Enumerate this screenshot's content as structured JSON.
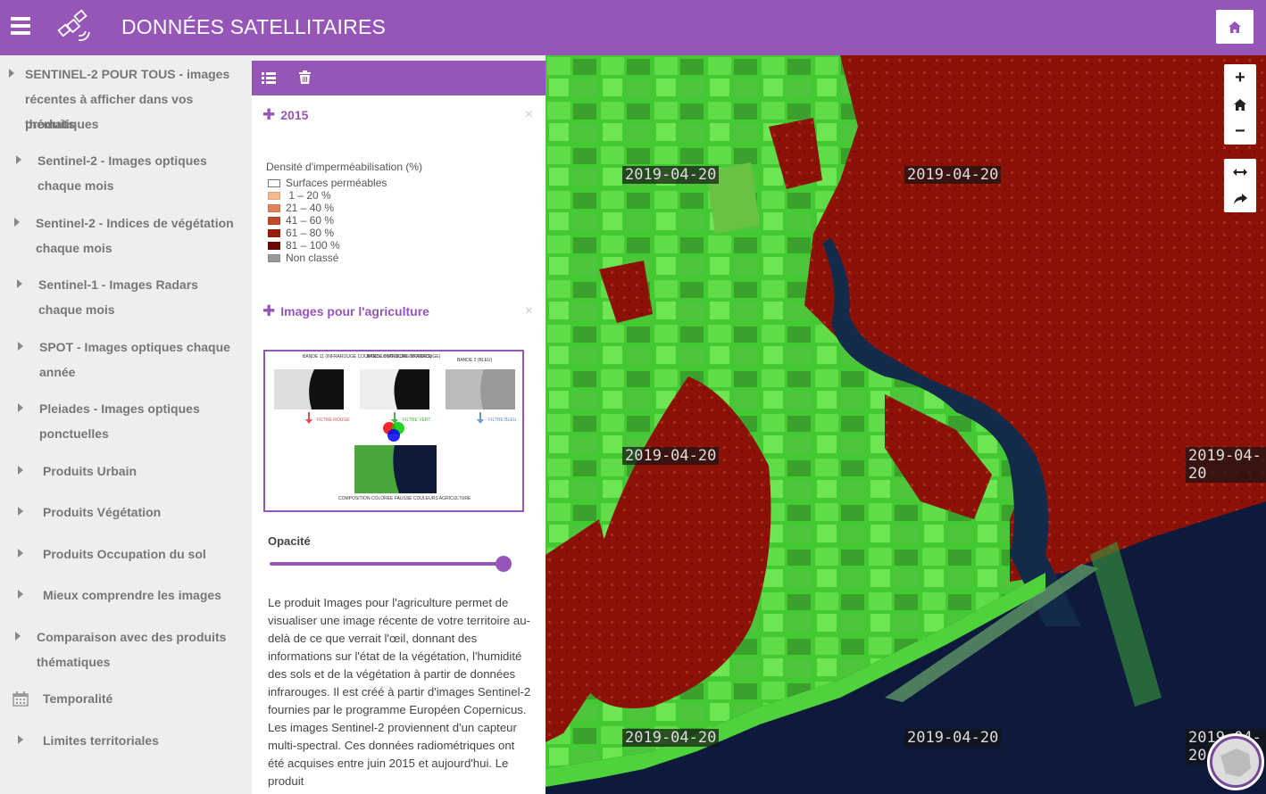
{
  "header": {
    "title": "DONNÉES SATELLITAIRES",
    "menu_icon": "hamburger-icon",
    "logo_icon": "satellite-icon",
    "home_icon": "home-icon"
  },
  "sidebar": {
    "items": [
      {
        "label_line1": "SENTINEL-2 POUR TOUS - images",
        "label_line2": "récentes à afficher dans vos produits",
        "label_line3": "thématiques"
      },
      {
        "label_line1": "Sentinel-2 - Images optiques",
        "label_line2": "chaque mois"
      },
      {
        "label_line1": "Sentinel-2 - Indices de végétation",
        "label_line2": "chaque mois"
      },
      {
        "label_line1": "Sentinel-1 - Images Radars",
        "label_line2": "chaque mois"
      },
      {
        "label_line1": "SPOT - Images optiques chaque",
        "label_line2": "année"
      },
      {
        "label_line1": "Pleiades - Images optiques",
        "label_line2": "ponctuelles"
      },
      {
        "label_line1": "Produits Urbain"
      },
      {
        "label_line1": "Produits Végétation"
      },
      {
        "label_line1": "Produits Occupation du sol"
      },
      {
        "label_line1": "Mieux comprendre les images"
      },
      {
        "label_line1": "Comparaison avec des produits",
        "label_line2": "thématiques"
      },
      {
        "label_line1": "Temporalité",
        "icon": "calendar-icon"
      },
      {
        "label_line1": "Limites territoriales"
      }
    ]
  },
  "panel": {
    "toolbar": {
      "list_icon": "list-icon",
      "trash_icon": "trash-icon"
    },
    "layer1": {
      "title": "2015",
      "close": "×"
    },
    "legend": {
      "title": "Densité d'imperméabilisation (%)",
      "rows": [
        {
          "label": "Surfaces perméables",
          "color": "#ffffff"
        },
        {
          "label": " 1 – 20 %",
          "color": "#f4b98c"
        },
        {
          "label": "21 – 40 %",
          "color": "#e0835a"
        },
        {
          "label": "41 – 60 %",
          "color": "#c24a2a"
        },
        {
          "label": "61 – 80 %",
          "color": "#9a1d0c"
        },
        {
          "label": "81 – 100 %",
          "color": "#6b0a05"
        },
        {
          "label": "Non classé",
          "color": "#999999"
        }
      ]
    },
    "layer2": {
      "title": "Images pour l'agriculture",
      "close": "×"
    },
    "diagram": {
      "band11": "BANDE 11 (INFRAROUGE COURTES LONGUEURS D'ONDES)",
      "band8": "BANDE 8 (PROCHE INFRAROUGE)",
      "band2": "BANDE 2 (BLEU)",
      "filter_red": "FILTRE ROUGE",
      "filter_green": "FILTRE VERT",
      "filter_blue": "FILTRE BLEU",
      "composition": "COMPOSITION COLORÉE FAUSSE COULEURS AGRICULTURE"
    },
    "opacity_label": "Opacité",
    "opacity_value": 1.0,
    "description": "Le produit Images pour l'agriculture permet de visualiser une image récente de votre territoire au-delà de ce que verrait l'œil, donnant des informations sur l'état de la végétation, l'humidité des sols et de la végétation à partir de données infrarouges. Il est créé à partir d'images Sentinel-2 fournies par le programme Européen Copernicus. Les images Sentinel-2 proviennent d'un capteur multi-spectral. Ces données radiométriques ont été acquises entre juin 2015 et aujourd'hui. Le produit"
  },
  "map": {
    "date_labels": [
      "2019-04-20",
      "2019-04-20",
      "2019-04-20",
      "2019-04-20",
      "2019-04-20",
      "2019-04-20",
      "2019-04-20"
    ],
    "controls": {
      "zoom_in": "+",
      "zoom_out": "−"
    }
  },
  "colors": {
    "accent": "#9556b8",
    "urban": "#8c1208",
    "vegetation": "#4ed43a",
    "water": "#0d1a3c"
  }
}
